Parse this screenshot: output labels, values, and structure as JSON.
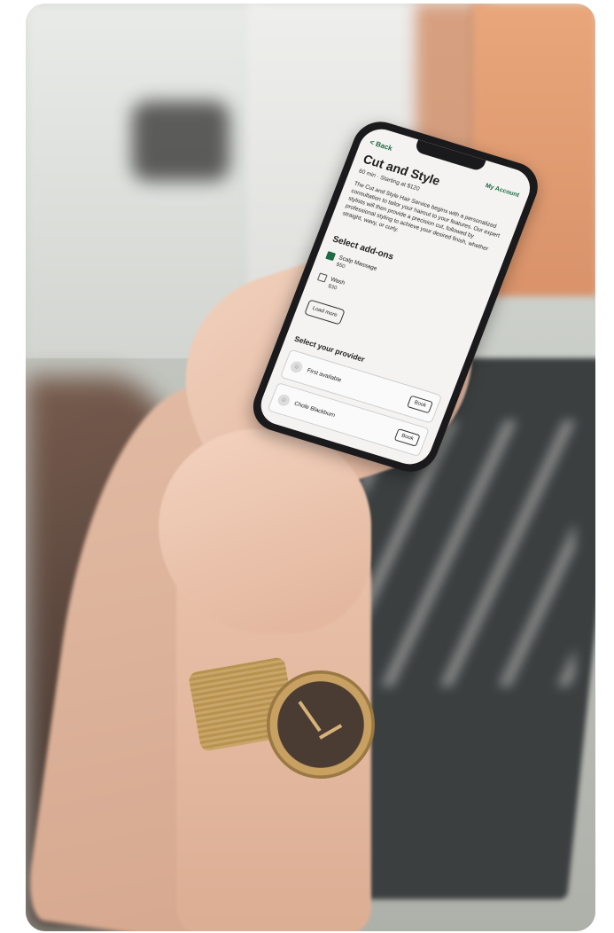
{
  "app": {
    "back_label": "< Back",
    "account_label": "My Account"
  },
  "service": {
    "title": "Cut and Style",
    "duration": "60 min",
    "price": "Starting at $120",
    "description": "The Cut and Style Hair Service begins with a personalized consultation to tailor your haircut to your features. Our expert stylists will then provide a precision cut, followed by professional styling to achieve your desired finish, whether straight, wavy, or curly."
  },
  "addons": {
    "title": "Select add-ons",
    "items": [
      {
        "label": "Scalp Massage",
        "price": "$50",
        "checked": true
      },
      {
        "label": "Wash",
        "price": "$30",
        "checked": false
      }
    ],
    "load_more": "Load more"
  },
  "providers": {
    "title": "Select your provider",
    "items": [
      {
        "name": "First available",
        "action": "Book"
      },
      {
        "name": "Chole Blackburn",
        "action": "Book"
      }
    ]
  },
  "colors": {
    "accent": "#1f6b45"
  }
}
